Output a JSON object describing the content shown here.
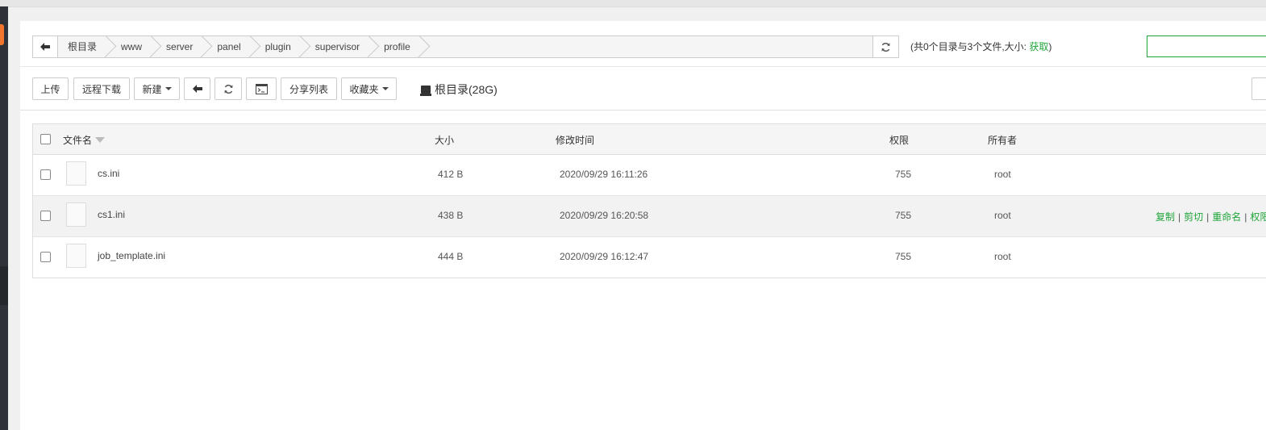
{
  "breadcrumb": {
    "items": [
      "根目录",
      "www",
      "server",
      "panel",
      "plugin",
      "supervisor",
      "profile"
    ]
  },
  "dir_info": {
    "prefix": "(共0个目录与3个文件,大小: ",
    "link": "获取",
    "suffix": ")"
  },
  "search": {
    "value": ""
  },
  "toolbar": {
    "upload": "上传",
    "remote_download": "远程下载",
    "new": "新建",
    "share_list": "分享列表",
    "favorites": "收藏夹",
    "disk": "根目录(28G)"
  },
  "table": {
    "headers": {
      "name": "文件名",
      "size": "大小",
      "mtime": "修改时间",
      "perm": "权限",
      "owner": "所有者"
    },
    "rows": [
      {
        "name": "cs.ini",
        "size": "412 B",
        "mtime": "2020/09/29 16:11:26",
        "perm": "755",
        "owner": "root"
      },
      {
        "name": "cs1.ini",
        "size": "438 B",
        "mtime": "2020/09/29 16:20:58",
        "perm": "755",
        "owner": "root"
      },
      {
        "name": "job_template.ini",
        "size": "444 B",
        "mtime": "2020/09/29 16:12:47",
        "perm": "755",
        "owner": "root"
      }
    ],
    "row_actions": [
      "复制",
      "剪切",
      "重命名",
      "权限"
    ]
  },
  "colors": {
    "accent_green": "#20a53a",
    "sidebar_dark": "#2f3238",
    "sidebar_orange": "#f2762e"
  }
}
